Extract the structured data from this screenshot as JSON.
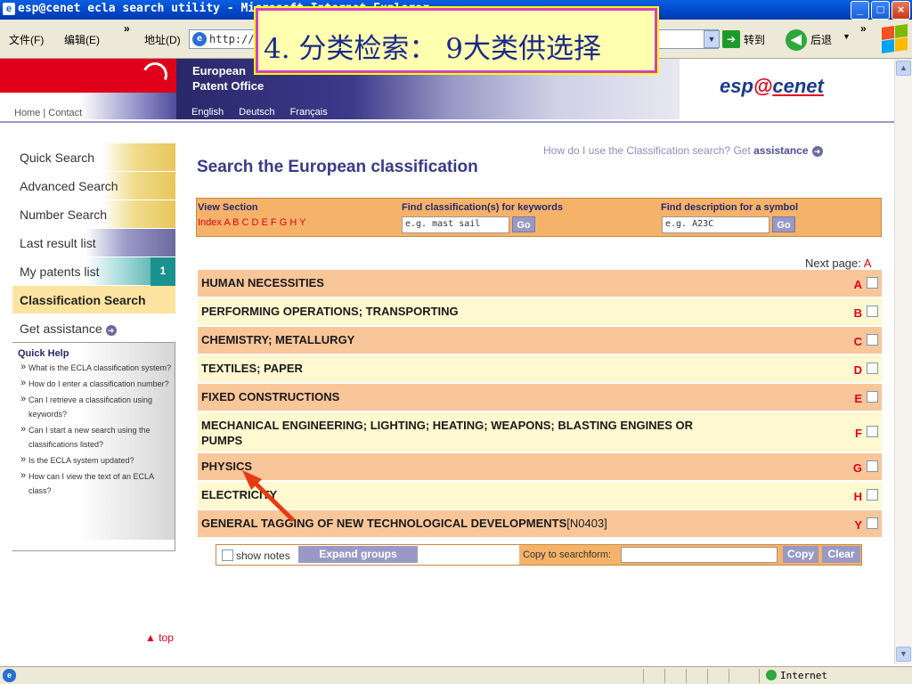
{
  "browser": {
    "title": "esp@cenet ecla search utility - Microsoft Internet Explorer",
    "menu_file": "文件(F)",
    "menu_edit": "编辑(E)",
    "menu_more": "»",
    "address_label": "地址(D)",
    "address_value": "http://v",
    "go_label": "转到",
    "back_label": "后退",
    "status_zone": "Internet"
  },
  "callout": {
    "text": "4.  分类检索：  9大类供选择"
  },
  "header": {
    "office_line1": "European",
    "office_line2": "Patent Office",
    "home_contact": "Home | Contact",
    "languages": [
      "English",
      "Deutsch",
      "Français"
    ],
    "logo_text_a": "esp",
    "logo_text_b": "@",
    "logo_text_c": "cenet"
  },
  "nav": {
    "items": [
      {
        "label": "Quick Search"
      },
      {
        "label": "Advanced Search"
      },
      {
        "label": "Number Search"
      },
      {
        "label": "Last result list"
      },
      {
        "label": "My patents list",
        "badge": "1"
      },
      {
        "label": "Classification Search"
      },
      {
        "label": "Get assistance"
      }
    ],
    "quick_help_title": "Quick Help",
    "quick_help": [
      "What is the ECLA classification system?",
      "How do I enter a classification number?",
      "Can I retrieve a classification using keywords?",
      "Can I start a new search using the classifications listed?",
      "Is the ECLA system updated?",
      "How can I view the text of an ECLA class?"
    ],
    "top_link": "▲ top"
  },
  "main": {
    "assist_text": "How do I use the Classification search? Get",
    "assist_bold": "assistance",
    "title": "Search the European classification",
    "view_section_label": "View Section",
    "index_text": "Index A B C D E F G H Y",
    "keywords_label": "Find classification(s) for keywords",
    "keywords_placeholder": "e.g. mast sail",
    "symbol_label": "Find description for a symbol",
    "symbol_placeholder": "e.g. A23C",
    "go_button": "Go",
    "next_page_label": "Next page:",
    "next_page_value": "A",
    "classes": [
      {
        "title": "HUMAN NECESSITIES",
        "letter": "A"
      },
      {
        "title": "PERFORMING OPERATIONS; TRANSPORTING",
        "letter": "B"
      },
      {
        "title": "CHEMISTRY; METALLURGY",
        "letter": "C"
      },
      {
        "title": "TEXTILES; PAPER",
        "letter": "D"
      },
      {
        "title": "FIXED CONSTRUCTIONS",
        "letter": "E"
      },
      {
        "title": "MECHANICAL ENGINEERING; LIGHTING; HEATING; WEAPONS; BLASTING ENGINES OR PUMPS",
        "letter": "F"
      },
      {
        "title": "PHYSICS",
        "letter": "G"
      },
      {
        "title": "ELECTRICITY",
        "letter": "H"
      },
      {
        "title": "GENERAL TAGGING OF NEW TECHNOLOGICAL DEVELOPMENTS",
        "suffix": "[N0403]",
        "letter": "Y"
      }
    ],
    "show_notes": "show notes",
    "expand_groups": "Expand groups",
    "copy_to_label": "Copy to searchform:",
    "copy_button": "Copy",
    "clear_button": "Clear"
  },
  "colors": {
    "accent_red": "#e1001a",
    "row_orange": "#f9c69a",
    "row_cream": "#fff8d0",
    "callout_border": "#d63fc6",
    "title_blue": "#3a3a8a"
  }
}
